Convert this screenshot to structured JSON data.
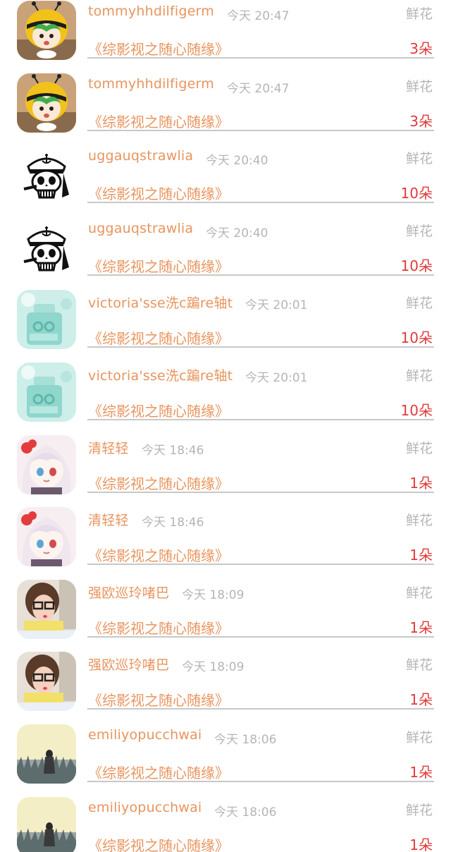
{
  "gifts": [
    {
      "user": "tommyhhdilfigerm",
      "time": "今天 20:47",
      "type": "鲜花",
      "title": "《综影视之随心随缘》",
      "count": "3朵",
      "avatar": "bee-cartoon-avatar"
    },
    {
      "user": "tommyhhdilfigerm",
      "time": "今天 20:47",
      "type": "鲜花",
      "title": "《综影视之随心随缘》",
      "count": "3朵",
      "avatar": "bee-cartoon-avatar"
    },
    {
      "user": "uggauqstrawlia",
      "time": "今天 20:40",
      "type": "鲜花",
      "title": "《综影视之随心随缘》",
      "count": "10朵",
      "avatar": "sailor-skull-avatar"
    },
    {
      "user": "uggauqstrawlia",
      "time": "今天 20:40",
      "type": "鲜花",
      "title": "《综影视之随心随缘》",
      "count": "10朵",
      "avatar": "sailor-skull-avatar"
    },
    {
      "user": "victoria'sse洗c蹁re轴t",
      "time": "今天 20:01",
      "type": "鲜花",
      "title": "《综影视之随心随缘》",
      "count": "10朵",
      "avatar": "glass-bottle-avatar"
    },
    {
      "user": "victoria'sse洗c蹁re轴t",
      "time": "今天 20:01",
      "type": "鲜花",
      "title": "《综影视之随心随缘》",
      "count": "10朵",
      "avatar": "glass-bottle-avatar"
    },
    {
      "user": "清轻轻",
      "time": "今天 18:46",
      "type": "鲜花",
      "title": "《综影视之随心随缘》",
      "count": "1朵",
      "avatar": "anime-girl-avatar"
    },
    {
      "user": "清轻轻",
      "time": "今天 18:46",
      "type": "鲜花",
      "title": "《综影视之随心随缘》",
      "count": "1朵",
      "avatar": "anime-girl-avatar"
    },
    {
      "user": "强欧巡玲啫巴",
      "time": "今天 18:09",
      "type": "鲜花",
      "title": "《综影视之随心随缘》",
      "count": "1朵",
      "avatar": "glasses-girl-avatar"
    },
    {
      "user": "强欧巡玲啫巴",
      "time": "今天 18:09",
      "type": "鲜花",
      "title": "《综影视之随心随缘》",
      "count": "1朵",
      "avatar": "glasses-girl-avatar"
    },
    {
      "user": "emiliyopucchwai",
      "time": "今天 18:06",
      "type": "鲜花",
      "title": "《综影视之随心随缘》",
      "count": "1朵",
      "avatar": "field-girl-avatar"
    },
    {
      "user": "emiliyopucchwai",
      "time": "今天 18:06",
      "type": "鲜花",
      "title": "《综影视之随心随缘》",
      "count": "1朵",
      "avatar": "field-girl-avatar"
    }
  ],
  "colors": {
    "username": "#e8945e",
    "time": "#b5b5b5",
    "count": "#e03a3a",
    "divider": "#c8c8c8"
  }
}
